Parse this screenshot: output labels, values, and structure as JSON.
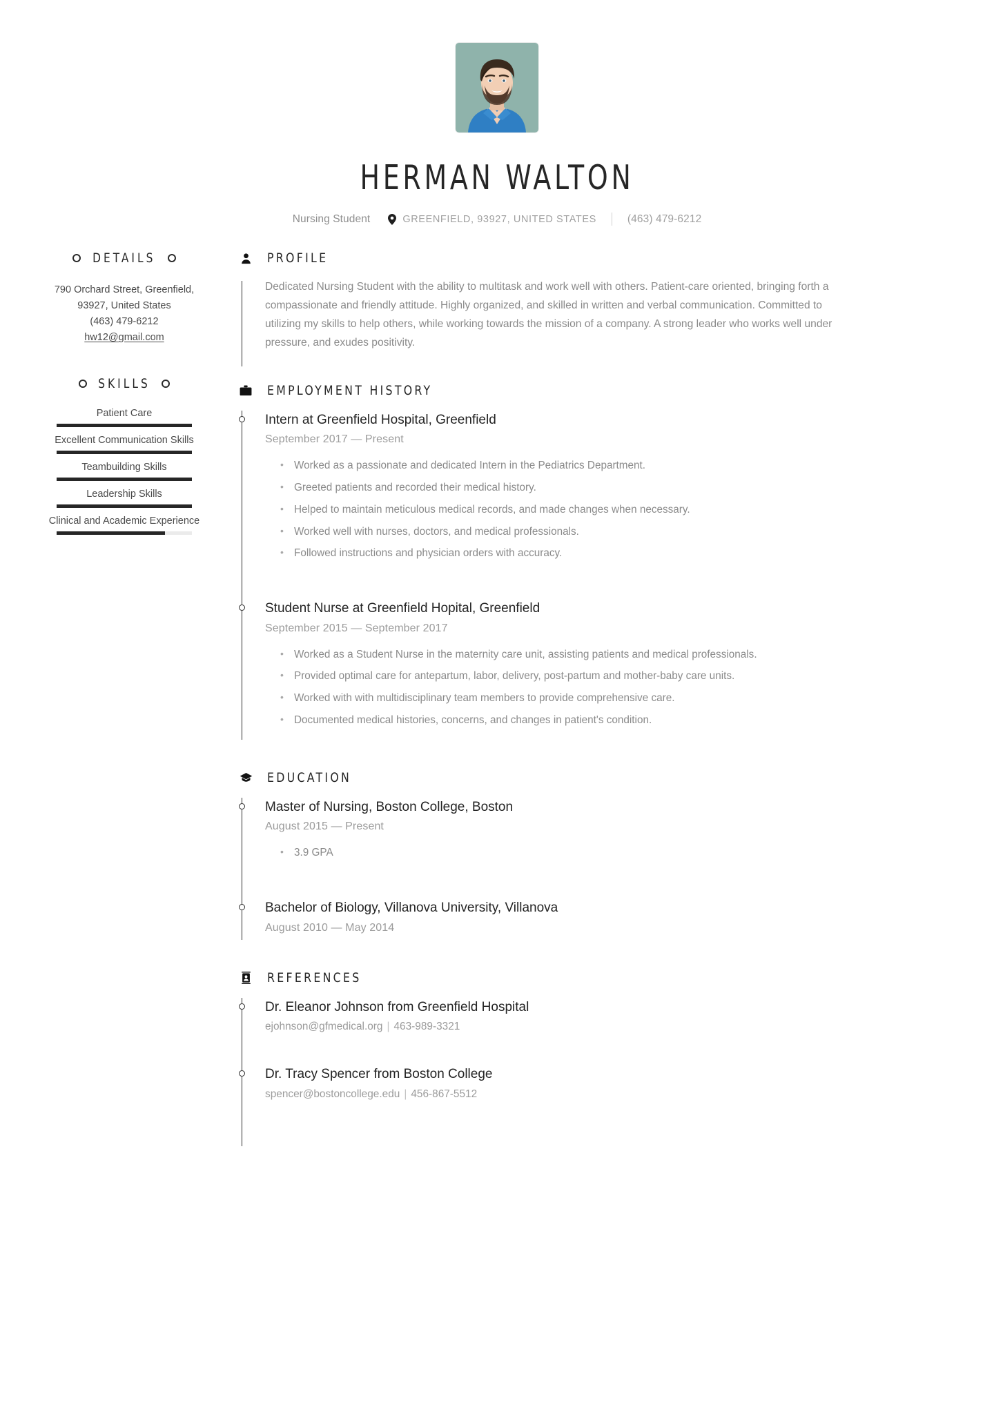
{
  "header": {
    "photo_alt": "profile-photo",
    "name": "HERMAN WALTON",
    "job_title": "Nursing Student",
    "location": "GREENFIELD, 93927, UNITED STATES",
    "phone": "(463) 479-6212"
  },
  "sidebar": {
    "details": {
      "heading": "DETAILS",
      "address_line1": "790 Orchard Street, Greenfield,",
      "address_line2": "93927, United States",
      "phone": "(463) 479-6212",
      "email": "hw12@gmail.com"
    },
    "skills": {
      "heading": "SKILLS",
      "items": [
        {
          "label": "Patient Care",
          "level": 100
        },
        {
          "label": "Excellent Communication Skills",
          "level": 100
        },
        {
          "label": "Teambuilding Skills",
          "level": 100
        },
        {
          "label": "Leadership Skills",
          "level": 100
        },
        {
          "label": "Clinical and Academic Experience",
          "level": 80
        }
      ]
    }
  },
  "main": {
    "profile": {
      "heading": "PROFILE",
      "icon": "person-icon",
      "text": "Dedicated Nursing Student with the ability to multitask and work well with others. Patient-care oriented, bringing forth a compassionate and friendly attitude. Highly organized, and skilled in written and verbal communication. Committed to utilizing my skills to help others, while working towards the mission of a company. A strong leader who works well under pressure, and exudes positivity."
    },
    "employment": {
      "heading": "EMPLOYMENT HISTORY",
      "icon": "briefcase-icon",
      "entries": [
        {
          "title": "Intern at  Greenfield Hospital, Greenfield",
          "date": "September 2017 — Present",
          "bullets": [
            "Worked as a passionate and dedicated Intern in the Pediatrics Department.",
            "Greeted patients and recorded their medical history.",
            "Helped to maintain meticulous medical records, and made changes when necessary.",
            "Worked well with nurses, doctors, and medical professionals.",
            "Followed instructions and physician orders with accuracy."
          ]
        },
        {
          "title": "Student Nurse at  Greenfield Hopital, Greenfield",
          "date": "September 2015 — September 2017",
          "bullets": [
            "Worked as a Student Nurse in the maternity care unit, assisting patients and medical professionals.",
            "Provided optimal care for antepartum, labor, delivery, post-partum and mother-baby care units.",
            "Worked with with multidisciplinary team members to provide comprehensive care.",
            "Documented medical histories, concerns, and changes in patient's condition."
          ]
        }
      ]
    },
    "education": {
      "heading": "EDUCATION",
      "icon": "graduation-cap-icon",
      "entries": [
        {
          "title": "Master of Nursing, Boston College, Boston",
          "date": "August 2015 — Present",
          "bullets": [
            "3.9 GPA"
          ]
        },
        {
          "title": "Bachelor of Biology, Villanova University, Villanova",
          "date": "August 2010 — May 2014",
          "bullets": []
        }
      ]
    },
    "references": {
      "heading": "REFERENCES",
      "icon": "contact-card-icon",
      "entries": [
        {
          "title": "Dr. Eleanor Johnson from Greenfield Hospital",
          "email": "ejohnson@gfmedical.org",
          "phone": "463-989-3321"
        },
        {
          "title": "Dr. Tracy Spencer from Boston College",
          "email": "spencer@bostoncollege.edu",
          "phone": "456-867-5512"
        }
      ]
    }
  },
  "colors": {
    "ink": "#262626",
    "muted": "#8a8a8a",
    "rule": "#ebebeb",
    "photo_bg": "#8fb3ab"
  }
}
